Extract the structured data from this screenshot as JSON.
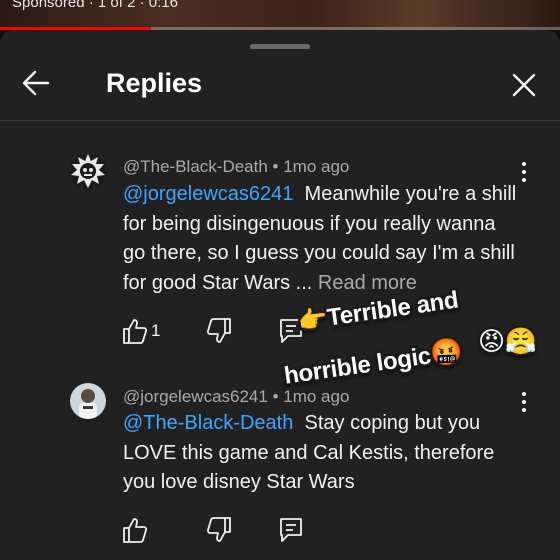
{
  "video": {
    "overlay_text": "Sponsored · 1 of 2 · 0:16",
    "progress_fraction": 0.27
  },
  "panel": {
    "title": "Replies"
  },
  "comments": [
    {
      "handle": "@The-Black-Death",
      "time": "1mo ago",
      "mention": "@jorgelewcas6241",
      "text": "Meanwhile you're a shill for being disingenuous if you really wanna go there, so I guess you could say I'm a shill for good Star Wars ...",
      "read_more": "Read more",
      "likes": "1"
    },
    {
      "handle": "@jorgelewcas6241",
      "time": "1mo ago",
      "mention": "@The-Black-Death",
      "text": "Stay coping but you LOVE this game and Cal Kestis, therefore you love disney Star Wars",
      "likes": ""
    }
  ],
  "sticker": {
    "line1": "Terrible and",
    "line2": "horrible logic",
    "pointer_emoji": "👉",
    "emojis": [
      "😡",
      "😤",
      "🤬"
    ]
  },
  "colors": {
    "background": "#0f0f0f",
    "sheet": "#212121",
    "mention": "#3ea6ff",
    "secondary": "#aaaaaa",
    "progress": "#ff0000"
  }
}
